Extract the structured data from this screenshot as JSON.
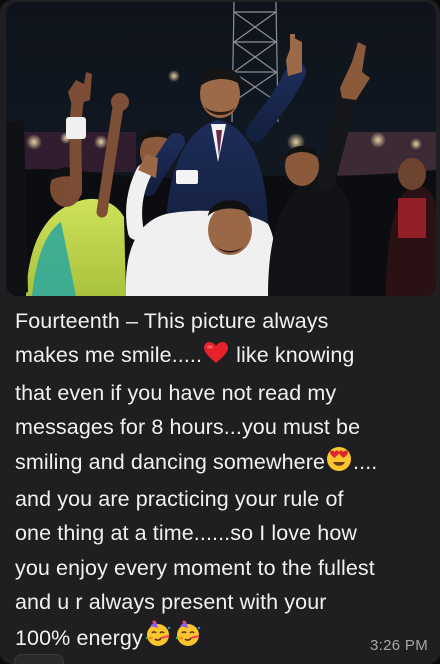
{
  "message": {
    "lines": [
      "Fourteenth – This picture always",
      "makes me smile.....",
      "like knowing",
      "that even if you have not read my",
      "messages for 8 hours...you must be",
      "smiling and dancing somewhere",
      "....",
      "and you are practicing your rule of",
      "one thing at a time......so I love how",
      "you enjoy every moment to the fullest",
      "and u r always present with your",
      "100% energy"
    ],
    "timestamp": "3:26 PM"
  },
  "icons": {
    "heart": "red-heart-emoji",
    "heart_eyes": "heart-eyes-emoji",
    "party": "partying-face-emoji"
  },
  "colors": {
    "bubble": "#1f1f21",
    "text": "#f1f1f1",
    "timestamp": "#a7a7a7"
  }
}
